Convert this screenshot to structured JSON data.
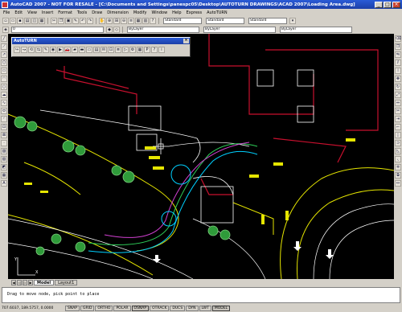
{
  "window": {
    "title": "AutoCAD 2007 - NOT FOR RESALE - [C:\\Documents and Settings\\panespc05\\Desktop\\AUTOTURN DRAWINGS\\ACAD 2007\\Loading Area.dwg]"
  },
  "menu": [
    "File",
    "Edit",
    "View",
    "Insert",
    "Format",
    "Tools",
    "Draw",
    "Dimension",
    "Modify",
    "Window",
    "Help",
    "Express",
    "AutoTURN"
  ],
  "toolbar": {
    "layer_combo": "0",
    "style_combo": "Standard",
    "dim_combo": "Standard",
    "table_combo": "Standard",
    "bylayer_1": "ByLayer",
    "bylayer_2": "ByLayer",
    "bylayer_3": "ByLayer"
  },
  "autoturn_panel": {
    "title": "AutoTURN"
  },
  "layout_tabs": [
    "Model",
    "Layout1"
  ],
  "command": {
    "line1": "",
    "line2": "Drag to move node, pick point to place"
  },
  "status": {
    "coords": "707.6037, 189.5757, 0.0000",
    "buttons": [
      "SNAP",
      "GRID",
      "ORTHO",
      "POLAR",
      "OSNAP",
      "OTRACK",
      "DUCS",
      "DYN",
      "LWT",
      "MODEL"
    ]
  },
  "colors": {
    "canvas": "#000000",
    "title_blue": "#1c3fa8",
    "road_yellow": "#e5e500",
    "building_red": "#c8102e",
    "tree_green": "#2f9b3a"
  }
}
